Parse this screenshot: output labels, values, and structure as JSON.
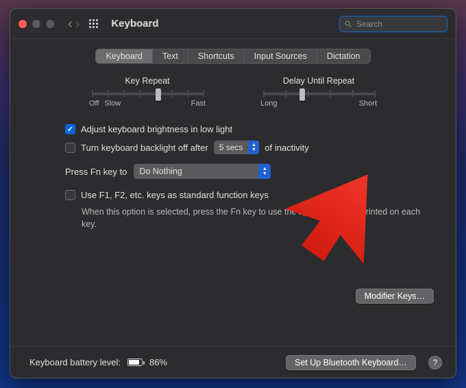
{
  "header": {
    "title": "Keyboard",
    "search_placeholder": "Search"
  },
  "tabs": [
    {
      "label": "Keyboard",
      "selected": true
    },
    {
      "label": "Text",
      "selected": false
    },
    {
      "label": "Shortcuts",
      "selected": false
    },
    {
      "label": "Input Sources",
      "selected": false
    },
    {
      "label": "Dictation",
      "selected": false
    }
  ],
  "sliders": {
    "key_repeat": {
      "label": "Key Repeat",
      "end_labels": [
        "Off",
        "Slow",
        "Fast"
      ],
      "value_pct": 60
    },
    "delay_repeat": {
      "label": "Delay Until Repeat",
      "end_labels": [
        "Long",
        "Short"
      ],
      "value_pct": 35
    }
  },
  "options": {
    "adjust_brightness": {
      "label": "Adjust keyboard brightness in low light",
      "checked": true
    },
    "backlight_off": {
      "prefix": "Turn keyboard backlight off after",
      "select_value": "5 secs",
      "suffix": "of inactivity",
      "checked": false
    },
    "press_fn": {
      "prefix": "Press Fn key to",
      "select_value": "Do Nothing"
    },
    "fn_keys": {
      "label": "Use F1, F2, etc. keys as standard function keys",
      "help": "When this option is selected, press the Fn key to use the special features printed on each key.",
      "checked": false
    }
  },
  "buttons": {
    "modifier_keys": "Modifier Keys…",
    "bluetooth": "Set Up Bluetooth Keyboard…"
  },
  "footer": {
    "battery_label": "Keyboard battery level:",
    "battery_pct": "86%",
    "battery_fill_pct": 86
  },
  "colors": {
    "accent": "#0a66d8",
    "arrow": "#f2362a"
  }
}
